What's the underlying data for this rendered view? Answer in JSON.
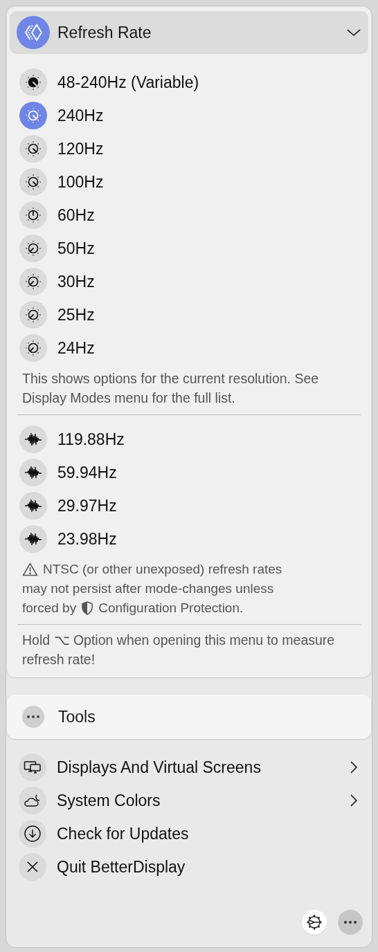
{
  "header": {
    "title": "Refresh Rate",
    "expanded": true
  },
  "rates": [
    {
      "label": "48-240Hz (Variable)",
      "kind": "variable",
      "selected": false
    },
    {
      "label": "240Hz",
      "kind": "high",
      "selected": true
    },
    {
      "label": "120Hz",
      "kind": "high",
      "selected": false
    },
    {
      "label": "100Hz",
      "kind": "high",
      "selected": false
    },
    {
      "label": "60Hz",
      "kind": "mid",
      "selected": false
    },
    {
      "label": "50Hz",
      "kind": "low",
      "selected": false
    },
    {
      "label": "30Hz",
      "kind": "low",
      "selected": false
    },
    {
      "label": "25Hz",
      "kind": "low",
      "selected": false
    },
    {
      "label": "24Hz",
      "kind": "low",
      "selected": false
    }
  ],
  "rates_note": "This shows options for the current resolution. See Display Modes menu for the full list.",
  "ntsc_rates": [
    {
      "label": "119.88Hz",
      "kind": "wave",
      "selected": false
    },
    {
      "label": "59.94Hz",
      "kind": "wave",
      "selected": false
    },
    {
      "label": "29.97Hz",
      "kind": "wave",
      "selected": false
    },
    {
      "label": "23.98Hz",
      "kind": "wave",
      "selected": false
    }
  ],
  "ntsc_warning": {
    "first_line": "NTSC (or other unexposed) refresh rates",
    "second_line": "may not persist after mode-changes unless",
    "third_line_start": "forced by",
    "third_line_end": "Configuration Protection."
  },
  "measure_hint": "Hold ⌥ Option when opening this menu to measure refresh rate!",
  "tools": {
    "label": "Tools"
  },
  "menu": [
    {
      "label": "Displays And Virtual Screens",
      "kind": "displays",
      "submenu": true
    },
    {
      "label": "System Colors",
      "kind": "colors",
      "submenu": true
    },
    {
      "label": "Check for Updates",
      "kind": "update",
      "submenu": false
    },
    {
      "label": "Quit BetterDisplay",
      "kind": "quit",
      "submenu": false
    }
  ]
}
